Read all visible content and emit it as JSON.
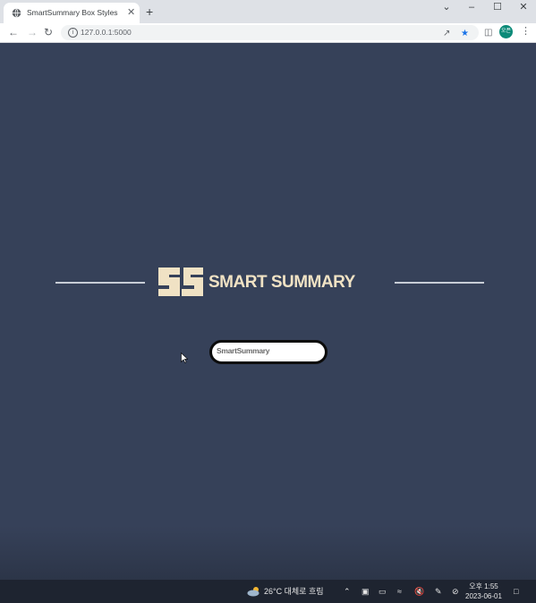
{
  "browser": {
    "tab_title": "SmartSummary Box Styles",
    "tab_close": "✕",
    "new_tab": "+",
    "url": "127.0.0.1:5000",
    "avatar_initials": "오픈",
    "window": {
      "minimize": "–",
      "maximize": "☐",
      "close": "✕",
      "dropdown": "⌄"
    }
  },
  "page": {
    "logo_text": "SMART SUMMARY",
    "box_label": "SmartSummary"
  },
  "taskbar": {
    "weather": "26°C 대체로 흐림",
    "time": "오후 1:55",
    "date": "2023-06-01"
  },
  "colors": {
    "page_background": "#364159",
    "logo_color": "#f0e2c4",
    "pill_border": "#0b0b0b"
  }
}
